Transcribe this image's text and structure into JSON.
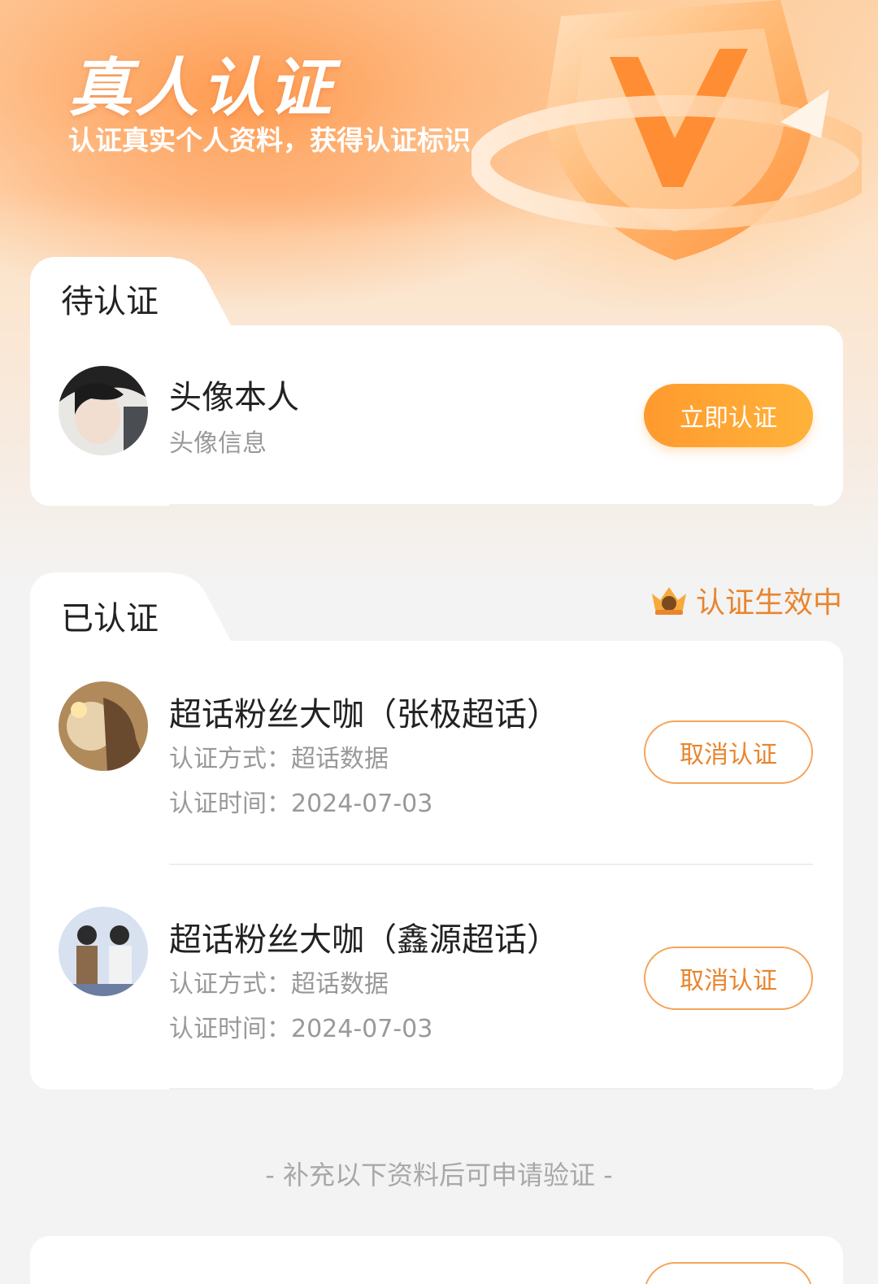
{
  "hero": {
    "title": "真人认证",
    "subtitle": "认证真实个人资料，获得认证标识"
  },
  "pending": {
    "tab_label": "待认证",
    "items": [
      {
        "title": "头像本人",
        "subtitle": "头像信息",
        "button_label": "立即认证"
      }
    ]
  },
  "verified": {
    "tab_label": "已认证",
    "status_label": "认证生效中",
    "items": [
      {
        "title": "超话粉丝大咖（张极超话）",
        "method": "认证方式：超话数据",
        "time": "认证时间：2024-07-03",
        "button_label": "取消认证"
      },
      {
        "title": "超话粉丝大咖（鑫源超话）",
        "method": "认证方式：超话数据",
        "time": "认证时间：2024-07-03",
        "button_label": "取消认证"
      }
    ]
  },
  "footer": {
    "note": "- 补充以下资料后可申请验证 -"
  },
  "colors": {
    "accent": "#ff9a2e",
    "accent_text": "#e8852d",
    "outline": "#f6a45a"
  },
  "icons": [
    "shield-check-icon",
    "crown-badge-icon"
  ]
}
